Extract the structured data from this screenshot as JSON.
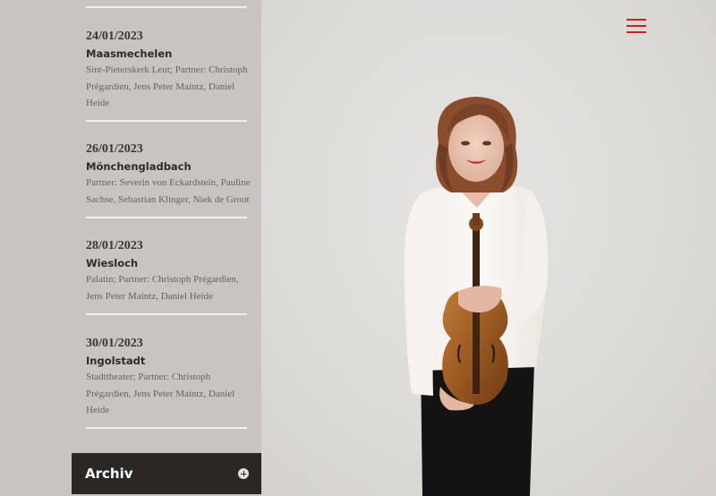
{
  "events": [
    {
      "date": "24/01/2023",
      "city": "Maasmechelen",
      "details": "Sint-Pieterskerk Leut; Partner: Christoph Prégardien, Jens Peter Maintz, Daniel Heide"
    },
    {
      "date": "26/01/2023",
      "city": "Mönchengladbach",
      "details": "Partner: Severin von Eckardstein, Pauline Sachse, Sebastian Klinger, Niek de Groot"
    },
    {
      "date": "28/01/2023",
      "city": "Wiesloch",
      "details": "Palatin; Partner: Christoph Prégardien, Jens Peter Maintz, Daniel Heide"
    },
    {
      "date": "30/01/2023",
      "city": "Ingolstadt",
      "details": "Stadttheater; Partner: Christoph Prégardien, Jens Peter Maintz, Daniel Heide"
    }
  ],
  "archive": {
    "label": "Archiv",
    "icon": "plus-circle-icon"
  },
  "menu": {
    "icon": "hamburger-menu-icon",
    "color": "#c8202a"
  },
  "colors": {
    "sidebar": "#c9c4c1",
    "archive_bar": "#2a2724",
    "accent": "#c8202a"
  }
}
